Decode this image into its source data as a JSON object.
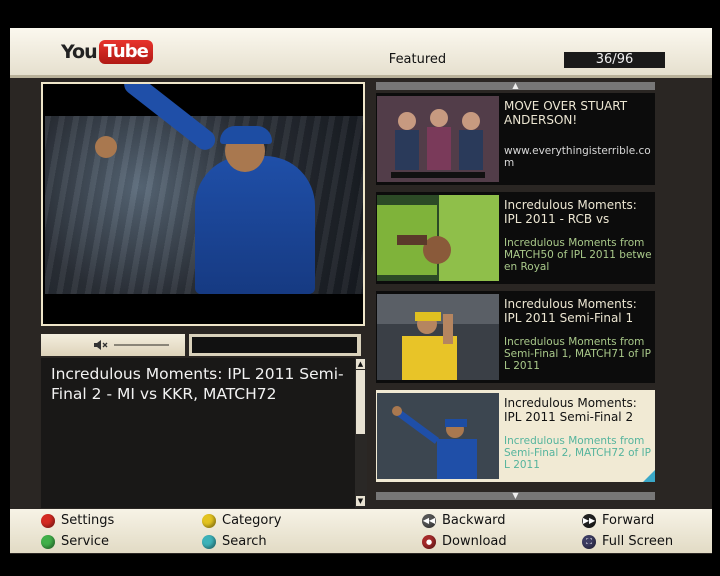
{
  "header": {
    "logo_you": "You",
    "logo_tube": "Tube",
    "section_title": "Featured",
    "page_counter": "36/96"
  },
  "player": {
    "video_title": "Incredulous Moments: IPL 2011 Semi-Final 2 - MI vs KKR, MATCH72",
    "speaker_icon": "speaker-mute-icon"
  },
  "list": {
    "items": [
      {
        "title": "MOVE OVER STUART ANDERSON!",
        "desc": "www.everythingisterrible.com",
        "selected": false
      },
      {
        "title": "Incredulous Moments: IPL 2011 - RCB vs",
        "desc": "Incredulous Moments from MATCH50 of IPL 2011 between Royal",
        "selected": false
      },
      {
        "title": "Incredulous Moments: IPL 2011 Semi-Final 1",
        "desc": "Incredulous Moments from Semi-Final 1, MATCH71 of IPL 2011",
        "selected": false
      },
      {
        "title": "Incredulous Moments: IPL 2011 Semi-Final 2",
        "desc": "Incredulous Moments from Semi-Final 2, MATCH72 of IPL 2011",
        "selected": true
      }
    ]
  },
  "footer": {
    "settings": "Settings",
    "category": "Category",
    "backward": "Backward",
    "forward": "Forward",
    "service": "Service",
    "search": "Search",
    "download": "Download",
    "full_screen": "Full Screen"
  },
  "colors": {
    "red": "#d42a22",
    "yellow": "#e3c320",
    "green": "#41b04a",
    "cyan": "#3db2b9",
    "selected_bg": "#f1ead4"
  }
}
